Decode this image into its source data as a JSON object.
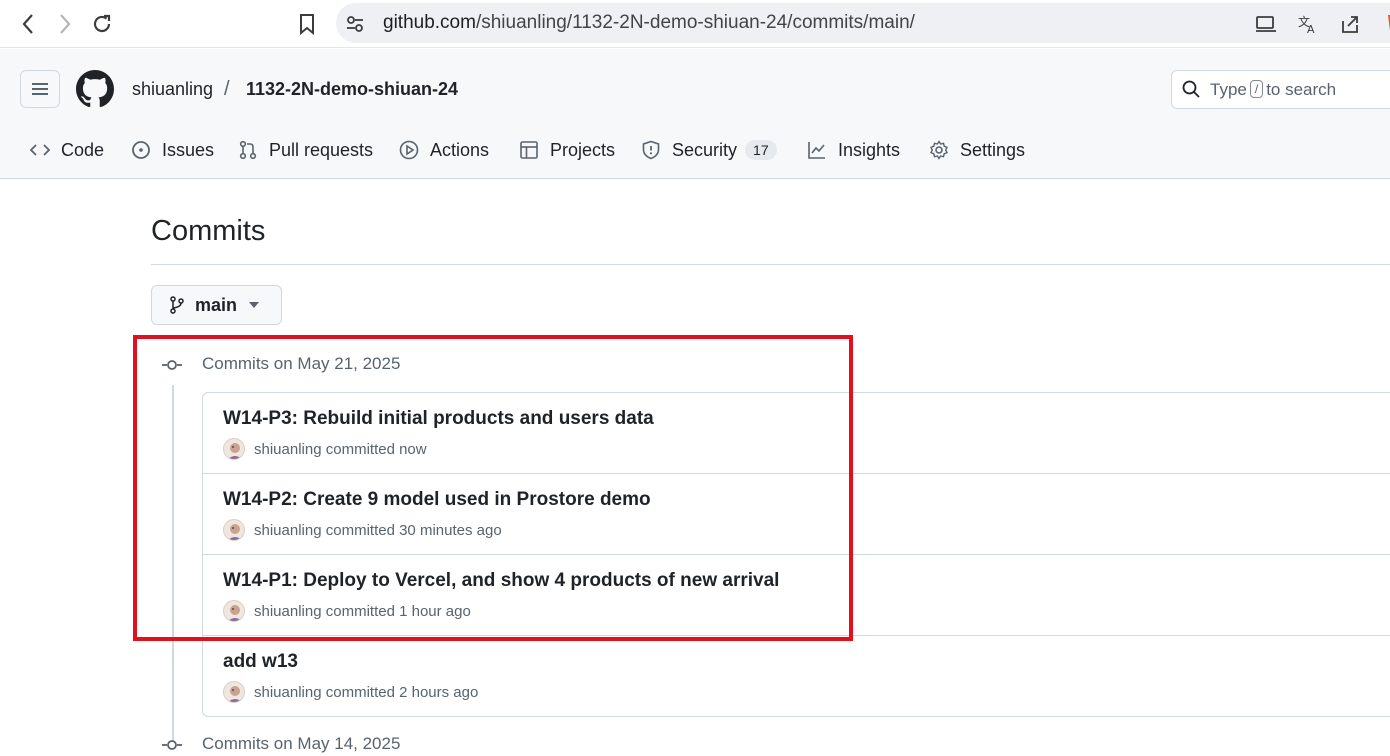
{
  "browser": {
    "url_host": "github.com",
    "url_path": "/shiuanling/1132-2N-demo-shiuan-24/commits/main/"
  },
  "header": {
    "owner": "shiuanling",
    "separator": "/",
    "repo": "1132-2N-demo-shiuan-24",
    "search_before": "Type",
    "search_key": "/",
    "search_after": "to search"
  },
  "tabs": [
    {
      "label": "Code",
      "icon": "code-icon"
    },
    {
      "label": "Issues",
      "icon": "issue-icon"
    },
    {
      "label": "Pull requests",
      "icon": "pull-request-icon"
    },
    {
      "label": "Actions",
      "icon": "play-icon"
    },
    {
      "label": "Projects",
      "icon": "table-icon"
    },
    {
      "label": "Security",
      "icon": "shield-icon",
      "count": "17"
    },
    {
      "label": "Insights",
      "icon": "graph-icon"
    },
    {
      "label": "Settings",
      "icon": "gear-icon"
    }
  ],
  "page": {
    "title": "Commits",
    "branch": "main"
  },
  "groups": [
    {
      "heading": "Commits on May 21, 2025",
      "commits": [
        {
          "title": "W14-P3: Rebuild initial products and users data",
          "author": "shiuanling",
          "verb": "committed",
          "time": "now"
        },
        {
          "title": "W14-P2: Create 9 model used in Prostore demo",
          "author": "shiuanling",
          "verb": "committed",
          "time": "30 minutes ago"
        },
        {
          "title": "W14-P1: Deploy to Vercel, and show 4 products of new arrival",
          "author": "shiuanling",
          "verb": "committed",
          "time": "1 hour ago"
        },
        {
          "title": "add w13",
          "author": "shiuanling",
          "verb": "committed",
          "time": "2 hours ago"
        }
      ]
    },
    {
      "heading": "Commits on May 14, 2025"
    }
  ],
  "colors": {
    "highlight": "#e0101c",
    "border": "#d1d9e0",
    "muted": "#59636e"
  }
}
